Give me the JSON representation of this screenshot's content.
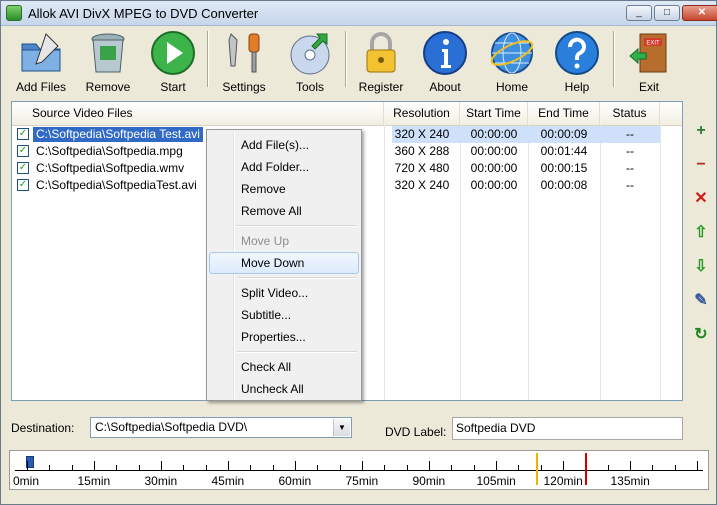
{
  "window": {
    "title": "Allok AVI DivX MPEG to DVD Converter",
    "btn_min": "_",
    "btn_max": "□",
    "btn_close": "✕"
  },
  "toolbar": {
    "add_files": "Add Files",
    "remove": "Remove",
    "start": "Start",
    "settings": "Settings",
    "tools": "Tools",
    "register": "Register",
    "about": "About",
    "home": "Home",
    "help": "Help",
    "exit": "Exit"
  },
  "list": {
    "headers": {
      "source": "Source Video Files",
      "resolution": "Resolution",
      "start_time": "Start Time",
      "end_time": "End Time",
      "status": "Status"
    },
    "rows": [
      {
        "checked": "✓",
        "file": "C:\\Softpedia\\Softpedia Test.avi",
        "resolution": "320 X 240",
        "start": "00:00:00",
        "end": "00:00:09",
        "status": "--"
      },
      {
        "checked": "✓",
        "file": "C:\\Softpedia\\Softpedia.mpg",
        "resolution": "360 X 288",
        "start": "00:00:00",
        "end": "00:01:44",
        "status": "--"
      },
      {
        "checked": "✓",
        "file": "C:\\Softpedia\\Softpedia.wmv",
        "resolution": "720 X 480",
        "start": "00:00:00",
        "end": "00:00:15",
        "status": "--"
      },
      {
        "checked": "✓",
        "file": "C:\\Softpedia\\SoftpediaTest.avi",
        "resolution": "320 X 240",
        "start": "00:00:00",
        "end": "00:00:08",
        "status": "--"
      }
    ]
  },
  "context_menu": {
    "add_files": "Add File(s)...",
    "add_folder": "Add Folder...",
    "remove": "Remove",
    "remove_all": "Remove All",
    "move_up": "Move Up",
    "move_down": "Move Down",
    "split_video": "Split Video...",
    "subtitle": "Subtitle...",
    "properties": "Properties...",
    "check_all": "Check All",
    "uncheck_all": "Uncheck All"
  },
  "side_tools": {
    "add": "+",
    "remove": "−",
    "delete": "✕",
    "up": "⇧",
    "down": "⇩",
    "edit": "✎",
    "refresh": "↻"
  },
  "destination": {
    "label": "Destination:",
    "value": "C:\\Softpedia\\Softpedia DVD\\",
    "arrow": "▼"
  },
  "dvd_label": {
    "label": "DVD Label:",
    "value": "Softpedia DVD"
  },
  "timeline": {
    "labels": [
      "0min",
      "15min",
      "30min",
      "45min",
      "60min",
      "75min",
      "90min",
      "105min",
      "120min",
      "135min"
    ],
    "warning_marker_min": 114,
    "limit_marker_min": 125,
    "marker_colors": {
      "warning": "#f0b400",
      "limit": "#d40000"
    }
  },
  "colors": {
    "selection": "#316ac5",
    "accent": "#316ac5"
  }
}
